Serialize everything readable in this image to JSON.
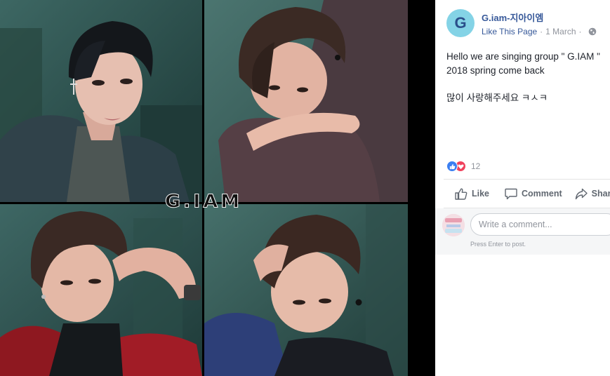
{
  "post": {
    "avatar_letter": "G",
    "page_name": "G.iam-지아이엠",
    "like_page": "Like This Page",
    "separator": "·",
    "date": "1 March",
    "text_line1": "Hello we are singing group \" G.IAM \"",
    "text_line2": "2018 spring come back",
    "text_line3": "많이 사랑해주세요 ㅋㅅㅋ"
  },
  "photo": {
    "logo_text": "G.IAM",
    "colors": {
      "teal_wall": "#2f5552",
      "dark": "#111a1a"
    }
  },
  "reactions": {
    "icons": [
      "like-icon",
      "love-icon"
    ],
    "count": "12"
  },
  "actions": {
    "like_label": "Like",
    "comment_label": "Comment",
    "share_label": "Share"
  },
  "comment_box": {
    "placeholder": "Write a comment...",
    "hint": "Press Enter to post."
  },
  "colors": {
    "link": "#365899",
    "muted": "#90949c",
    "avatar_bg": "#84d3e6",
    "like_blue": "#3b7ff1",
    "love_red": "#f0415c"
  }
}
